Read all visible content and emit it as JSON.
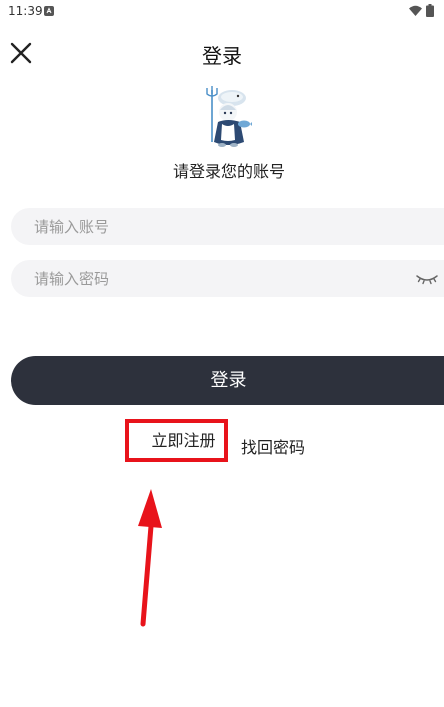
{
  "status_bar": {
    "time": "11:39"
  },
  "header": {
    "title": "登录"
  },
  "subtitle": "请登录您的账号",
  "form": {
    "account_placeholder": "请输入账号",
    "password_placeholder": "请输入密码",
    "login_label": "登录"
  },
  "links": {
    "register_label": "立即注册",
    "forgot_label": "找回密码"
  },
  "colors": {
    "login_button_bg": "#2d313c",
    "input_bg": "#f4f4f6",
    "annotation_red": "#e8131b"
  },
  "icons": {
    "close": "close-icon",
    "eye": "eye-closed-icon",
    "wifi": "wifi-icon",
    "battery": "battery-icon",
    "notification": "notification-icon"
  }
}
